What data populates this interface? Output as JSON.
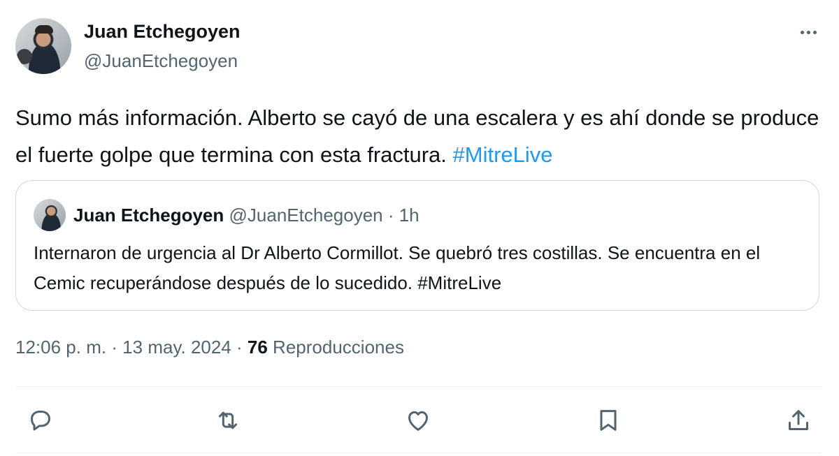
{
  "author": {
    "name": "Juan Etchegoyen",
    "handle": "@JuanEtchegoyen"
  },
  "tweet": {
    "text_before_hashtag": "Sumo más información. Alberto se cayó de una escalera y es ahí donde se produce el fuerte golpe que termina con esta fractura. ",
    "hashtag": "#MitreLive"
  },
  "quoted_tweet": {
    "name": "Juan Etchegoyen",
    "meta": "@JuanEtchegoyen · 1h",
    "text": "Internaron de urgencia al Dr Alberto Cormillot. Se quebró tres costillas. Se encuentra en el Cemic recuperándose después de lo sucedido. #MitreLive"
  },
  "meta": {
    "timestamp": "12:06 p. m. · 13 may. 2024 · ",
    "views_count": "76",
    "views_label": " Reproducciones"
  },
  "icons": {
    "more": "more-icon",
    "reply": "reply-icon",
    "retweet": "retweet-icon",
    "like": "heart-icon",
    "bookmark": "bookmark-icon",
    "share": "share-icon"
  },
  "colors": {
    "text": "#0f1419",
    "secondary": "#536471",
    "link": "#1d9bf0",
    "border": "#cfd9de"
  }
}
